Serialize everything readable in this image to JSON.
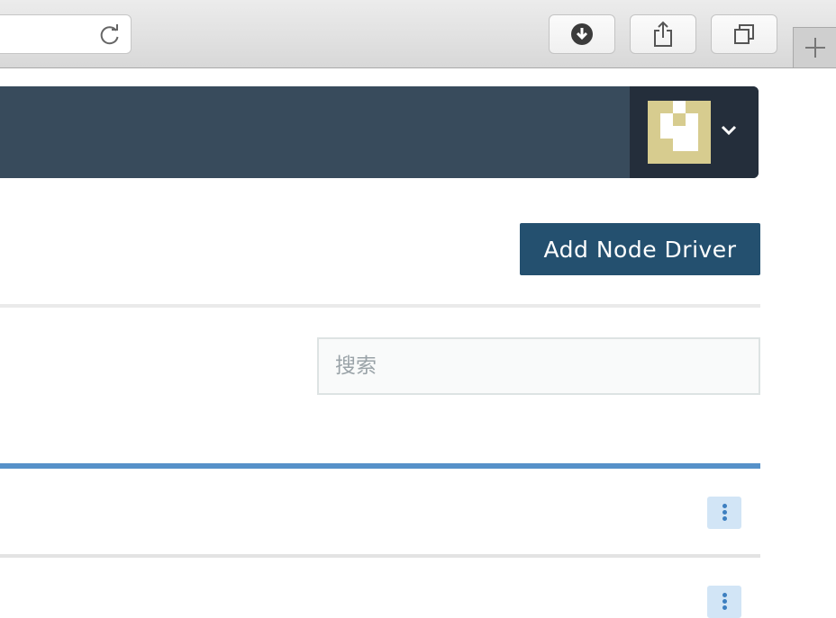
{
  "browser": {
    "icons": {
      "reload": "reload-icon",
      "download": "download-icon",
      "share": "share-icon",
      "tabs": "tabs-icon",
      "new_tab": "plus-icon"
    }
  },
  "header": {
    "user_menu_icon": "chevron-down-icon",
    "avatar_colors": {
      "background": "#d7cc8f",
      "foreground": "#ffffff"
    }
  },
  "actions": {
    "add_node_driver_label": "Add Node Driver"
  },
  "search": {
    "placeholder": "搜索",
    "value": ""
  },
  "table": {
    "rows": [
      {
        "menu_icon": "kebab-menu-icon"
      },
      {
        "menu_icon": "kebab-menu-icon"
      }
    ]
  },
  "colors": {
    "header_bg": "#384b5c",
    "user_menu_bg": "#242e3b",
    "primary_button": "#24506f",
    "table_accent": "#5691c9",
    "kebab_bg": "#d2e5f6"
  }
}
